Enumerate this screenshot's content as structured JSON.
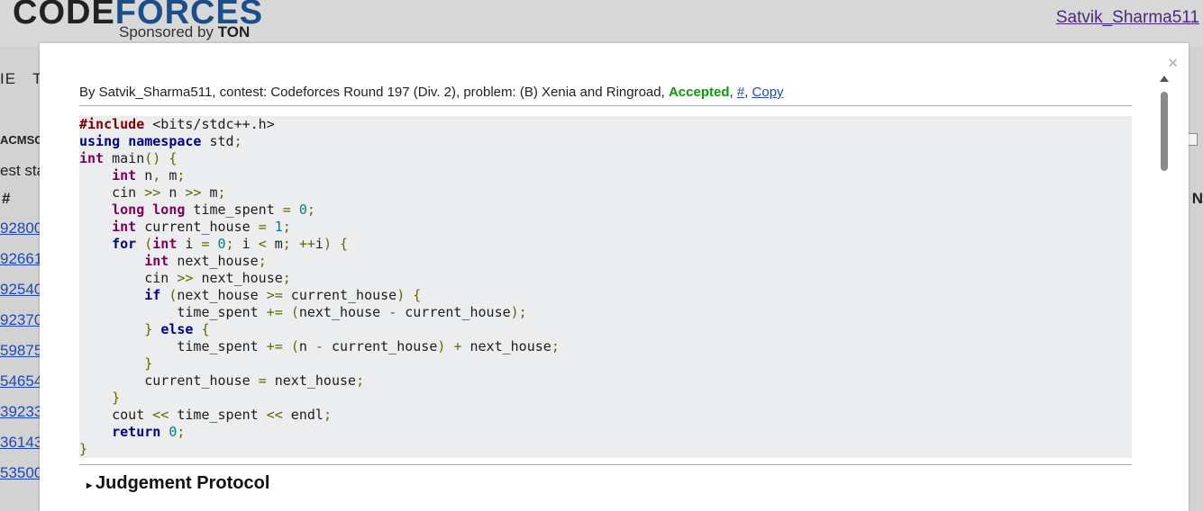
{
  "header": {
    "logo_code": "CODE",
    "logo_forces": "FORCES",
    "sponsor_prefix": "Sponsored by",
    "sponsor_name": "TON",
    "user": "Satvik_Sharma511"
  },
  "background": {
    "menu_fragments": [
      "IE",
      "TO"
    ],
    "acm_fragment": "ACMSGUI",
    "status_fragment": "est sta",
    "hash_header": "#",
    "m_header": "N",
    "submission_ids": [
      "92800",
      "92661",
      "92540",
      "92370",
      "59875",
      "54654",
      "39233",
      "36143",
      "53500"
    ]
  },
  "modal": {
    "close": "×",
    "meta": {
      "prefix": "By Satvik_Sharma511, contest: Codeforces Round 197 (Div. 2), problem: (B) Xenia and Ringroad, ",
      "verdict": "Accepted",
      "comma1": ", ",
      "hash_link": "#",
      "comma2": ", ",
      "copy_link": "Copy"
    },
    "code_lines": [
      "#include <bits/stdc++.h>",
      "using namespace std;",
      "int main() {",
      "    int n, m;",
      "    cin >> n >> m;",
      "    long long time_spent = 0;",
      "    int current_house = 1;",
      "    for (int i = 0; i < m; ++i) {",
      "        int next_house;",
      "        cin >> next_house;",
      "        if (next_house >= current_house) {",
      "            time_spent += (next_house - current_house);",
      "        } else {",
      "            time_spent += (n - current_house) + next_house;",
      "        }",
      "        current_house = next_house;",
      "    }",
      "    cout << time_spent << endl;",
      "    return 0;",
      "}"
    ],
    "judgement_title": "Judgement Protocol"
  },
  "colors": {
    "accepted": "#0a9a0a",
    "link": "#1f49b3",
    "code_bg": "#ebedef"
  }
}
